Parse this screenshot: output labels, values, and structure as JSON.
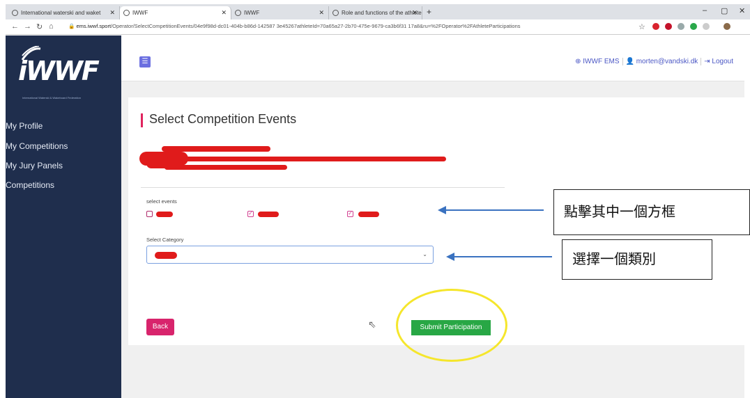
{
  "browser": {
    "tabs": [
      {
        "label": "International waterski and waket"
      },
      {
        "label": "IWWF"
      },
      {
        "label": "IWWF"
      },
      {
        "label": "Role and functions of the athlete"
      }
    ],
    "new_tab": "+",
    "window_controls": [
      "–",
      "▢",
      "✕"
    ],
    "url_domain": "ems.iwwf.sport",
    "url_path": "/Operator/SelectCompetitionEvents/04e9f98d-dc01-404b-b86d-142587 3e45267athleteId=70a65a27-2b70-475e-9679-ca3b6f31 17a8&ru=%2FOperator%2FAthleteParticipations"
  },
  "sidebar": {
    "logo_text": "iWWF",
    "logo_sub": "International Waterski & Wakeboard Federation",
    "items": [
      {
        "label": "My Profile"
      },
      {
        "label": "My Competitions"
      },
      {
        "label": "My Jury Panels"
      },
      {
        "label": "Competitions"
      }
    ]
  },
  "header": {
    "links": [
      {
        "label": "⊕ IWWF EMS"
      },
      {
        "label": "👤 morten@vandski.dk"
      },
      {
        "label": "⇥ Logout"
      }
    ]
  },
  "main": {
    "title": "Select Competition Events",
    "select_events_label": "select events",
    "select_category_label": "Select Category",
    "back_label": "Back",
    "submit_label": "Submit Participation"
  },
  "annotations": {
    "callout_checkbox": "點擊其中一個方框",
    "callout_category": "選擇一個類別"
  },
  "colors": {
    "sidebar": "#1f2e4d",
    "accent_pink": "#d8246c",
    "submit_green": "#28a745",
    "highlight_yellow": "#f5e62c",
    "arrow_blue": "#3a72c0",
    "redaction_red": "#e01b1b"
  }
}
